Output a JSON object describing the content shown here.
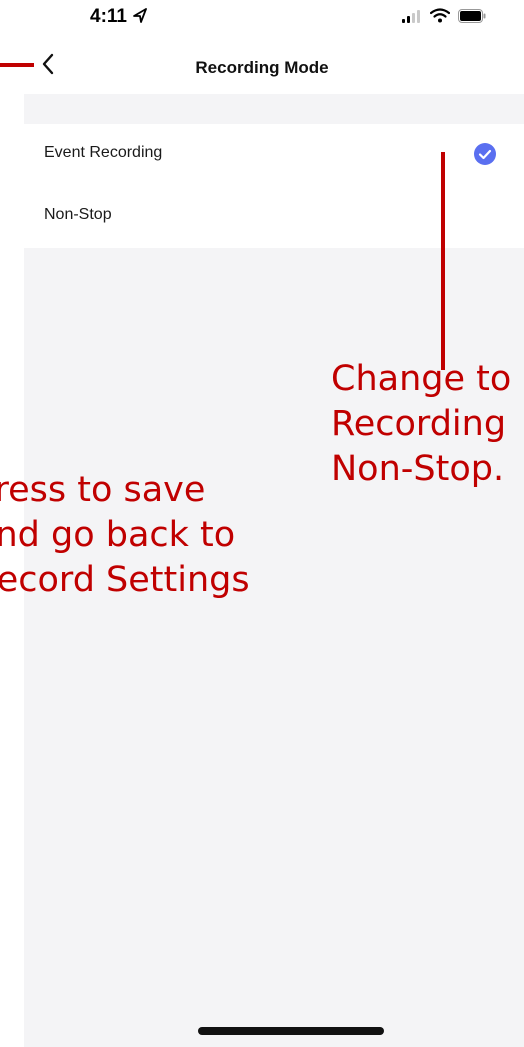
{
  "status_bar": {
    "time": "4:11",
    "location_icon": "location-arrow-icon",
    "signal_icon": "cellular-signal-icon",
    "wifi_icon": "wifi-icon",
    "battery_icon": "battery-icon"
  },
  "nav": {
    "title": "Recording Mode",
    "back_icon": "chevron-left-icon"
  },
  "options": [
    {
      "label": "Event Recording",
      "selected": true
    },
    {
      "label": "Non-Stop",
      "selected": false
    }
  ],
  "annotations": {
    "change_note_lines": [
      "Change to",
      "Recording",
      "Non-Stop."
    ],
    "save_note_lines": [
      "Press to save",
      "and go back to",
      "Record Settings"
    ]
  },
  "colors": {
    "accent": "#5a6ff0",
    "annotation": "#c00000",
    "background": "#f4f4f6"
  }
}
